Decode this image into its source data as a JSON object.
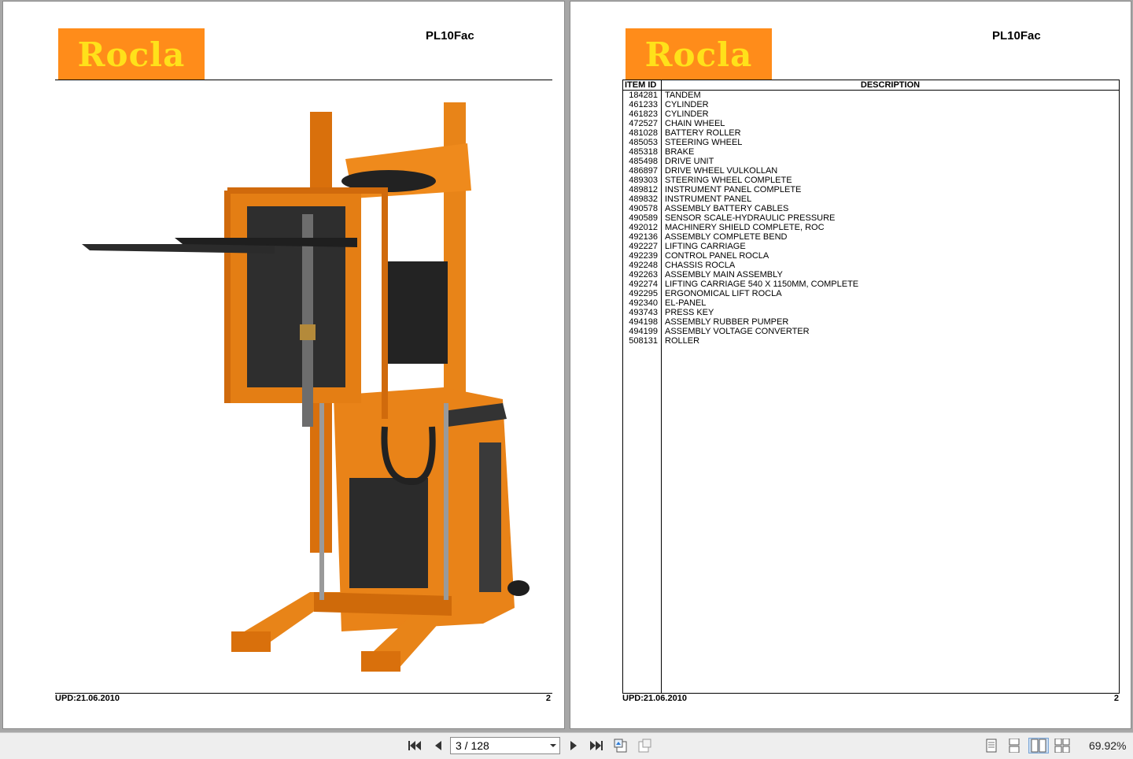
{
  "header": {
    "logo_text": "Rocla",
    "model": "PL10Fac"
  },
  "footer": {
    "update": "UPD:21.06.2010",
    "page_number": "2"
  },
  "parts_table": {
    "columns": [
      "ITEM ID",
      "DESCRIPTION"
    ],
    "rows": [
      [
        "184281",
        "TANDEM"
      ],
      [
        "461233",
        "CYLINDER"
      ],
      [
        "461823",
        "CYLINDER"
      ],
      [
        "472527",
        "CHAIN WHEEL"
      ],
      [
        "481028",
        "BATTERY ROLLER"
      ],
      [
        "485053",
        "STEERING WHEEL"
      ],
      [
        "485318",
        "BRAKE"
      ],
      [
        "485498",
        "DRIVE UNIT"
      ],
      [
        "486897",
        "DRIVE WHEEL VULKOLLAN"
      ],
      [
        "489303",
        "STEERING WHEEL COMPLETE"
      ],
      [
        "489812",
        "INSTRUMENT PANEL COMPLETE"
      ],
      [
        "489832",
        "INSTRUMENT PANEL"
      ],
      [
        "490578",
        "ASSEMBLY BATTERY CABLES"
      ],
      [
        "490589",
        "SENSOR SCALE-HYDRAULIC PRESSURE"
      ],
      [
        "492012",
        "MACHINERY SHIELD COMPLETE, ROC"
      ],
      [
        "492136",
        "ASSEMBLY COMPLETE BEND"
      ],
      [
        "492227",
        "LIFTING CARRIAGE"
      ],
      [
        "492239",
        "CONTROL PANEL ROCLA"
      ],
      [
        "492248",
        "CHASSIS ROCLA"
      ],
      [
        "492263",
        "ASSEMBLY MAIN ASSEMBLY"
      ],
      [
        "492274",
        "LIFTING CARRIAGE 540 X 1150MM, COMPLETE"
      ],
      [
        "492295",
        "ERGONOMICAL LIFT ROCLA"
      ],
      [
        "492340",
        "EL-PANEL"
      ],
      [
        "493743",
        "PRESS KEY"
      ],
      [
        "494198",
        "ASSEMBLY RUBBER PUMPER"
      ],
      [
        "494199",
        "ASSEMBLY VOLTAGE CONVERTER"
      ],
      [
        "508131",
        "ROLLER"
      ]
    ]
  },
  "toolbar": {
    "page_indicator": "3 / 128",
    "zoom": "69.92%",
    "icons": [
      "first-page-icon",
      "previous-page-icon",
      "next-page-icon",
      "last-page-icon",
      "go-back-icon",
      "go-forward-icon",
      "single-page-view-icon",
      "continuous-view-icon",
      "facing-pages-view-icon",
      "continuous-facing-view-icon"
    ],
    "active_view": "facing-pages-view-icon"
  },
  "colors": {
    "brand_orange": "#ff8c1a",
    "logo_yellow": "#ffe11a",
    "machine_orange": "#e07a10",
    "page_bg": "#a7a7a7"
  }
}
